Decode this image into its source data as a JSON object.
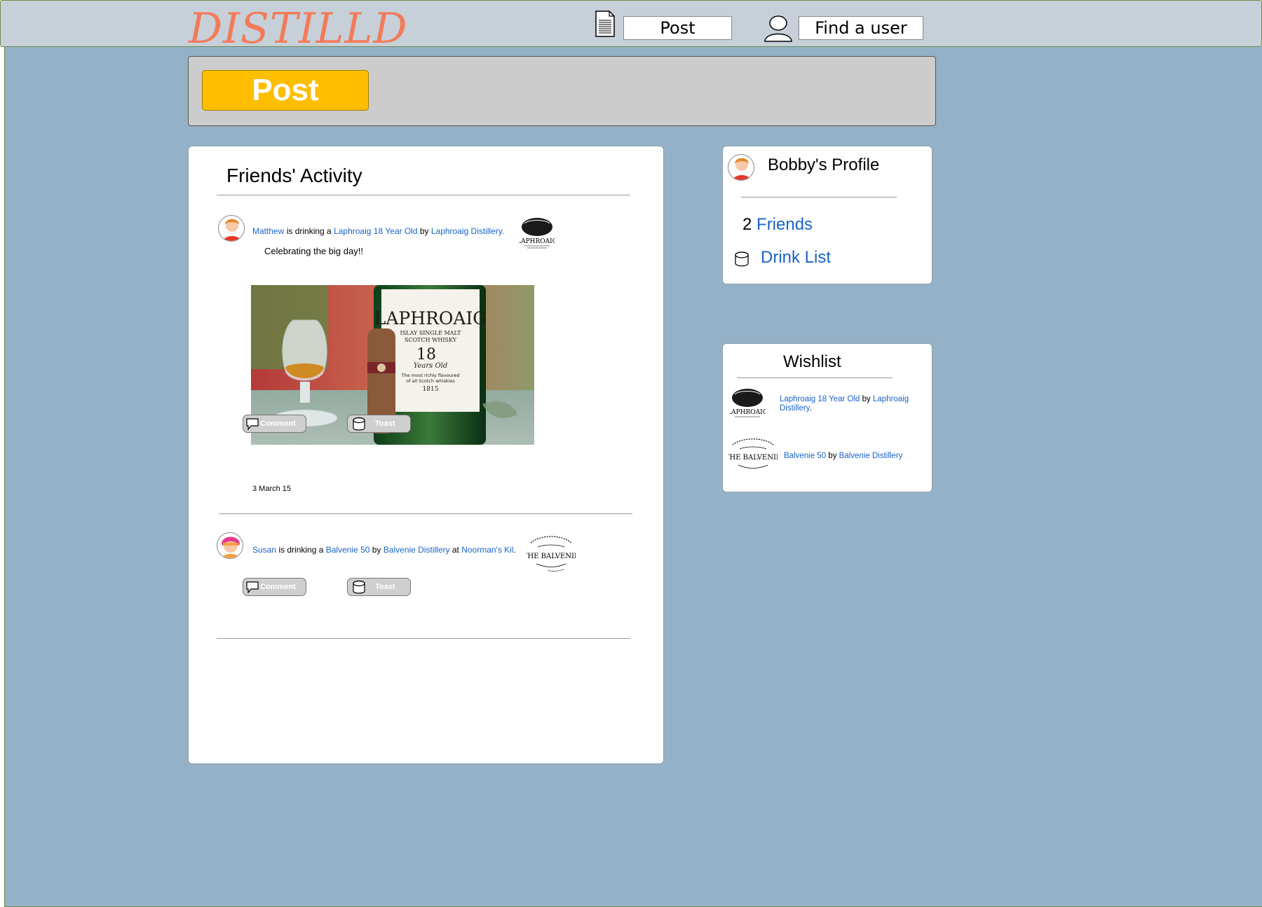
{
  "header": {
    "logo": "DISTILLD",
    "post_label": "Post",
    "find_user_label": "Find a user"
  },
  "post_panel": {
    "post_button": "Post"
  },
  "feed": {
    "title": "Friends' Activity",
    "items": [
      {
        "user": "Matthew",
        "verb": " is drinking a ",
        "drink": "Laphroaig 18 Year Old",
        "by": " by ",
        "distillery": "Laphroaig Distillery.",
        "comment": "Celebrating the big day!!",
        "comment_label": "Comment",
        "toast_label": "Toast",
        "date": "3 March 15",
        "photo_bottle_text": "LAPHROAIG",
        "photo_sub1": "ISLAY SINGLE MALT",
        "photo_sub2": "SCOTCH WHISKY",
        "photo_age": "18",
        "photo_age_sub": "Years Old",
        "photo_tagline1": "The most richly flavoured",
        "photo_tagline2": "of all Scotch whiskies",
        "photo_year": "1815",
        "logo_text": "LAPHROAIG"
      },
      {
        "user": "Susan",
        "verb": " is drinking a ",
        "drink": "Balvenie 50",
        "by": " by ",
        "distillery": "Balvenie Distillery",
        "at": " at ",
        "place": "Noorman's Kil",
        "end": ".",
        "comment_label": "Comment",
        "toast_label": "Toast",
        "logo_text": "THE BALVENIE"
      }
    ]
  },
  "profile": {
    "title": "Bobby's Profile",
    "friends_count": "2",
    "friends_label": "Friends",
    "drink_list_label": "Drink List"
  },
  "wishlist": {
    "title": "Wishlist",
    "items": [
      {
        "drink": "Laphroaig 18 Year Old",
        "by": " by ",
        "distillery_line1": "Laphroaig",
        "distillery_line2": "Distillery",
        "end": ".",
        "logo_text": "LAPHROAIG"
      },
      {
        "drink": "Balvenie 50",
        "by": " by ",
        "distillery": "Balvenie Distillery",
        "logo_text": "THE BALVENIE"
      }
    ]
  },
  "colors": {
    "logo": "#f27b5a",
    "background": "#94b1c7",
    "post_button": "#ffbe00",
    "link": "#1a63c7"
  },
  "icons": [
    "document-icon",
    "user-icon",
    "comment-icon",
    "glass-icon",
    "avatar"
  ]
}
